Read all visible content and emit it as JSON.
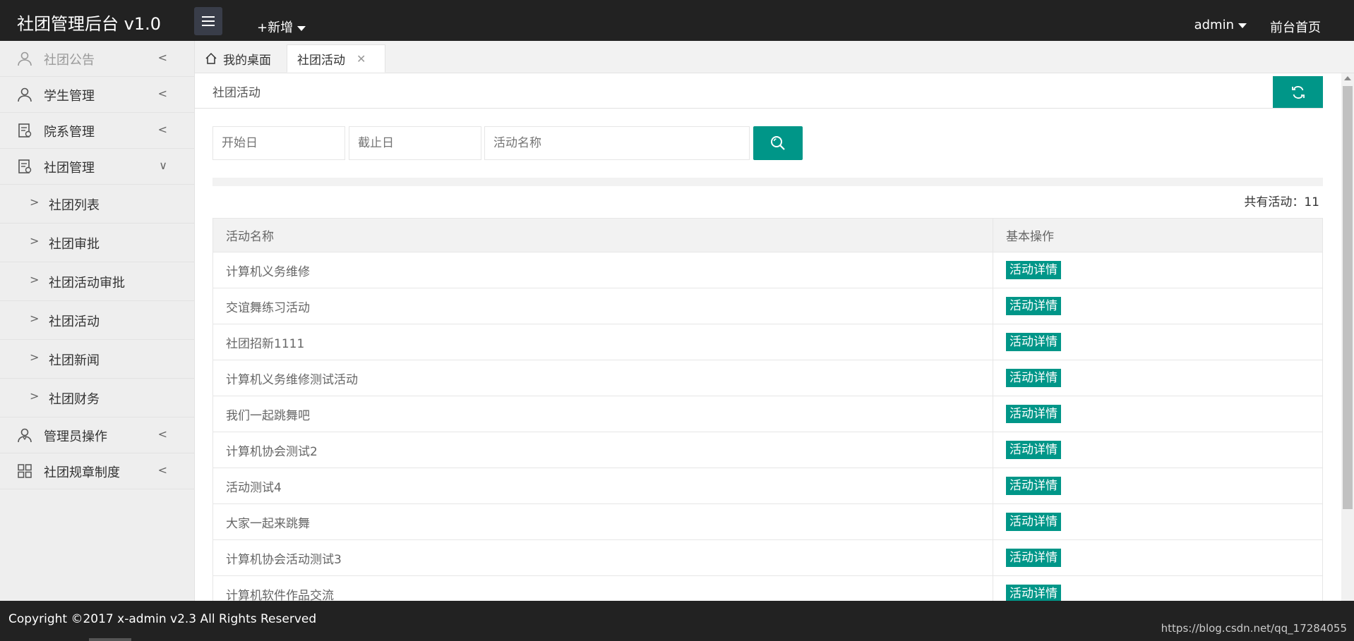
{
  "header": {
    "brand": "社团管理后台 v1.0",
    "new_label": "+新增",
    "user": "admin",
    "front_home": "前台首页"
  },
  "sidebar": {
    "items": [
      {
        "label": "社团公告",
        "icon": "user-icon"
      },
      {
        "label": "学生管理",
        "icon": "user-icon"
      },
      {
        "label": "院系管理",
        "icon": "document-icon"
      },
      {
        "label": "社团管理",
        "icon": "document-icon"
      }
    ],
    "sub_items": [
      "社团列表",
      "社团审批",
      "社团活动审批",
      "社团活动",
      "社团新闻",
      "社团财务"
    ],
    "bottom_items": [
      {
        "label": "管理员操作",
        "icon": "admin-icon"
      },
      {
        "label": "社团规章制度",
        "icon": "grid-icon"
      }
    ]
  },
  "tabs": {
    "home": "我的桌面",
    "active": "社团活动"
  },
  "breadcrumb": "社团活动",
  "search": {
    "start_placeholder": "开始日",
    "end_placeholder": "截止日",
    "name_placeholder": "活动名称"
  },
  "total_label": "共有活动：11",
  "table": {
    "headers": [
      "活动名称",
      "基本操作"
    ],
    "action_label": "活动详情",
    "rows": [
      "计算机义务维修",
      "交谊舞练习活动",
      "社团招新1111",
      "计算机义务维修测试活动",
      "我们一起跳舞吧",
      "计算机协会测试2",
      "活动测试4",
      "大家一起来跳舞",
      "计算机协会活动测试3",
      "计算机软件作品交流"
    ]
  },
  "footer": {
    "copyright": "Copyright ©2017 x-admin v2.3 All Rights Reserved",
    "watermark": "https://blog.csdn.net/qq_17284055"
  },
  "colors": {
    "accent": "#009688",
    "header_bg": "#222222",
    "sidebar_bg": "#eeeeee"
  }
}
